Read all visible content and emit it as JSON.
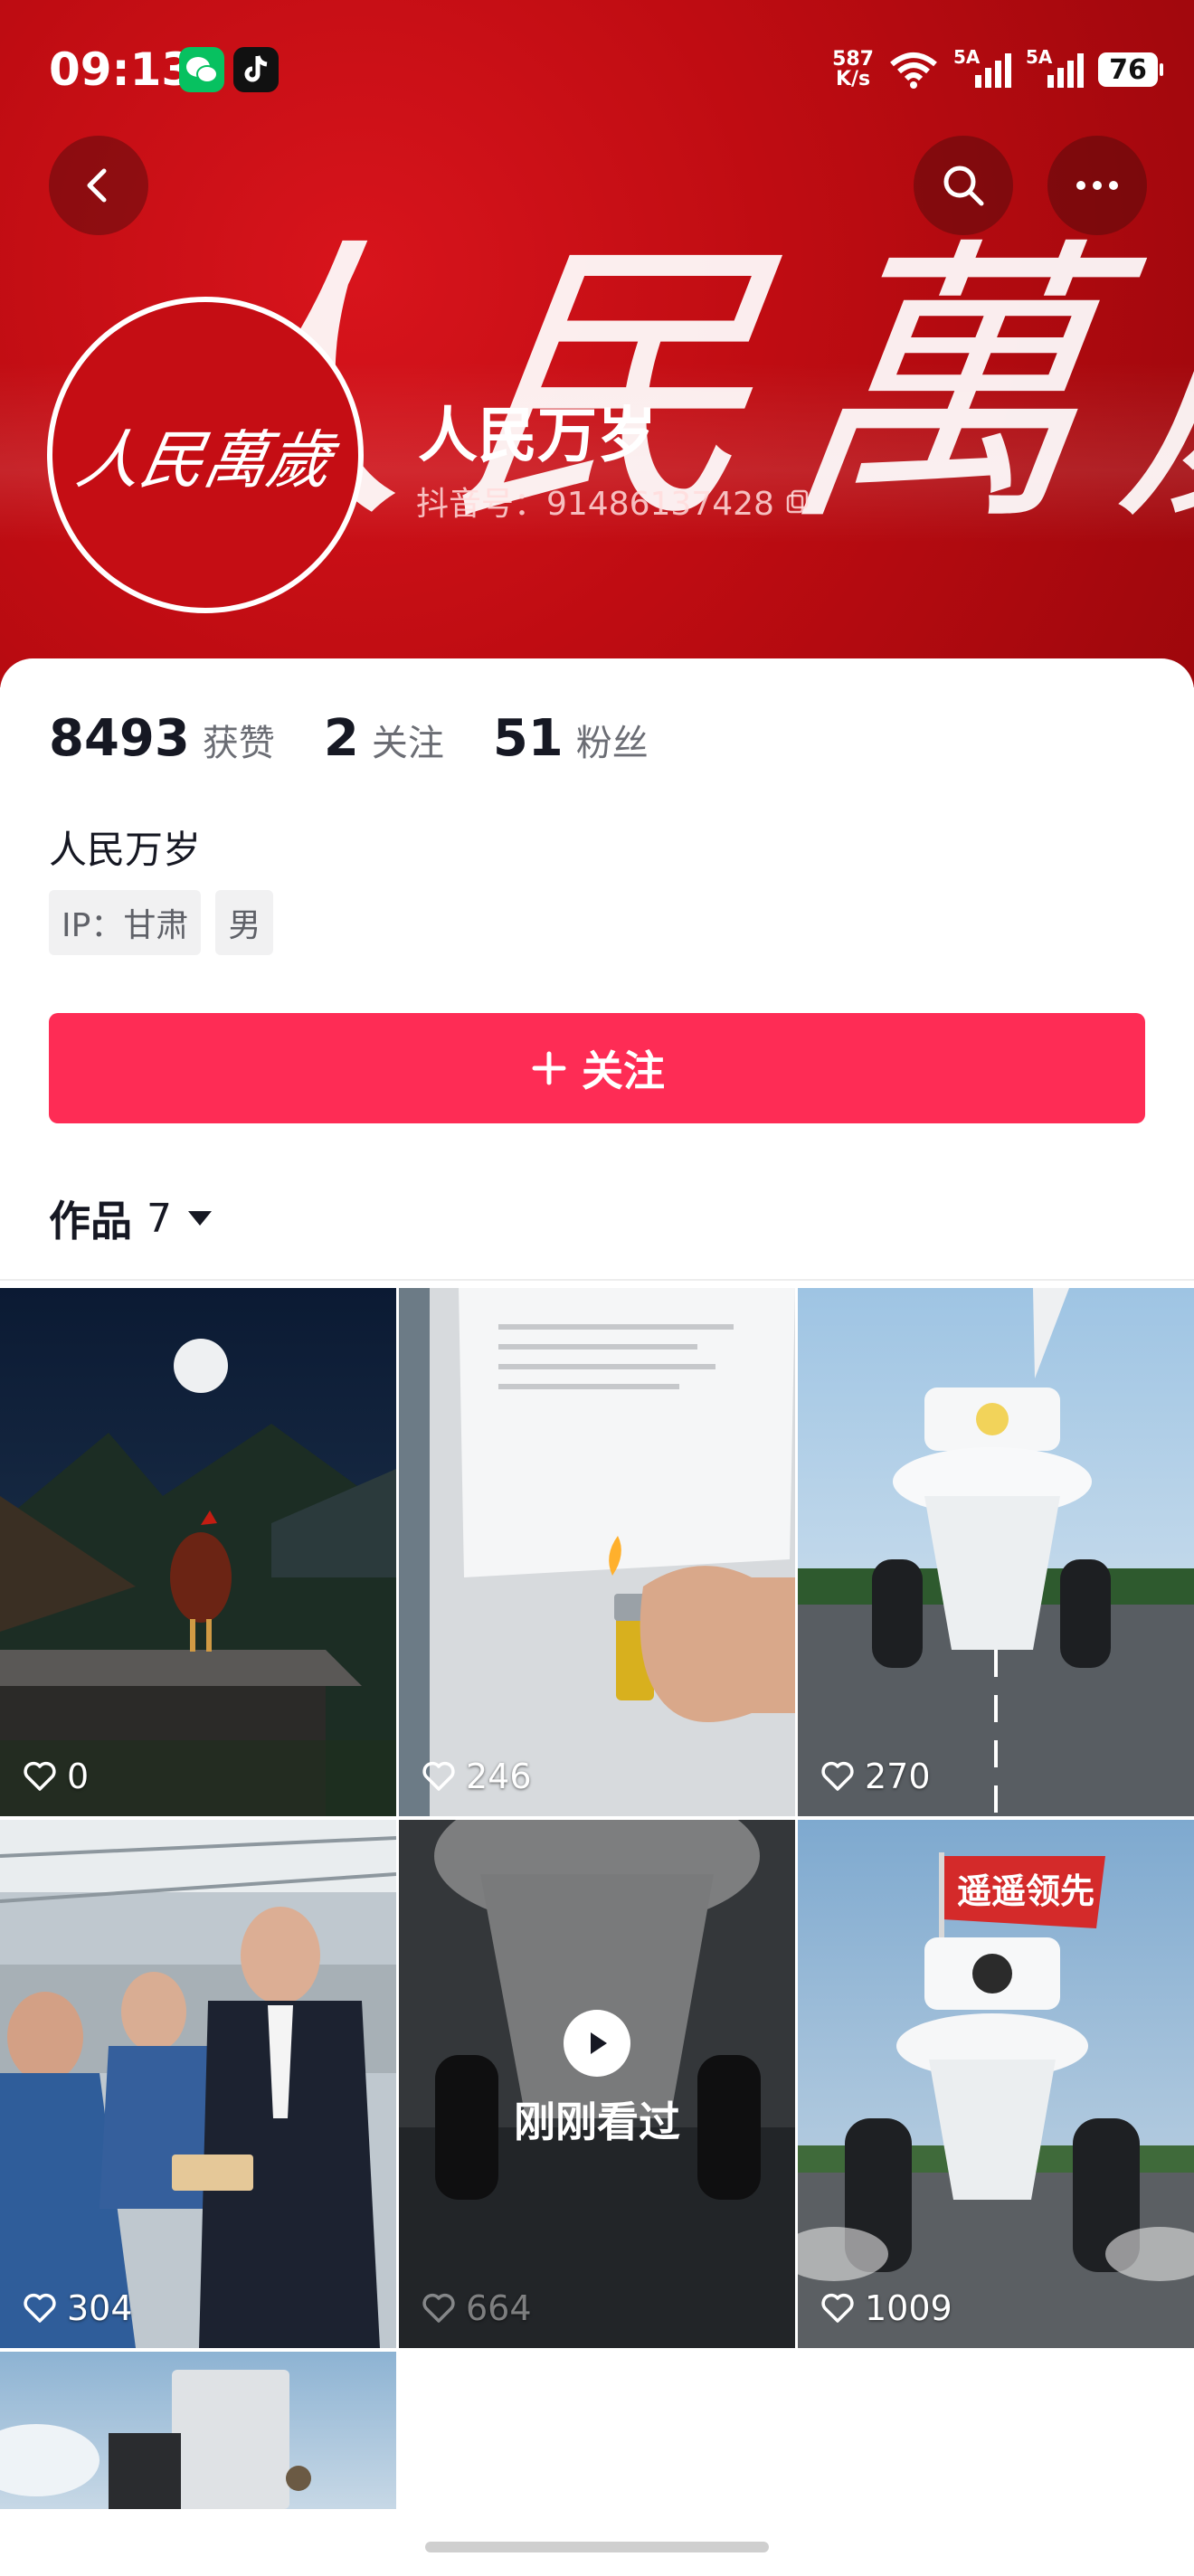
{
  "status_bar": {
    "time": "09:13",
    "net_speed_value": "587",
    "net_speed_unit": "K/s",
    "sig1_label": "5A",
    "sig2_label": "5A",
    "battery": "76"
  },
  "header": {
    "banner_text": "人民萬歲",
    "avatar_text": "人民萬歲",
    "nickname": "人民万岁",
    "douyin_id": "抖音号：91486137428"
  },
  "stats": [
    {
      "value": "8493",
      "label": "获赞"
    },
    {
      "value": "2",
      "label": "关注"
    },
    {
      "value": "51",
      "label": "粉丝"
    }
  ],
  "bio": "人民万岁",
  "tags": [
    "IP：甘肃",
    "男"
  ],
  "follow_button": {
    "icon": "plus-icon",
    "label": "关注"
  },
  "works_tab": {
    "label": "作品",
    "count": "7"
  },
  "videos": [
    {
      "likes": "0",
      "scene": "rooster-moon"
    },
    {
      "likes": "246",
      "scene": "paper-lighter"
    },
    {
      "likes": "270",
      "scene": "toilet-car"
    },
    {
      "likes": "304",
      "scene": "factory-workers"
    },
    {
      "likes": "664",
      "scene": "toilet-rear",
      "overlay": "刚刚看过"
    },
    {
      "likes": "1009",
      "scene": "toilet-flag",
      "flag_text": "遥遥领先"
    },
    {
      "likes": "",
      "scene": "machine-partial"
    }
  ],
  "colors": {
    "accent": "#fe2c55",
    "banner_red": "#c50d14"
  }
}
